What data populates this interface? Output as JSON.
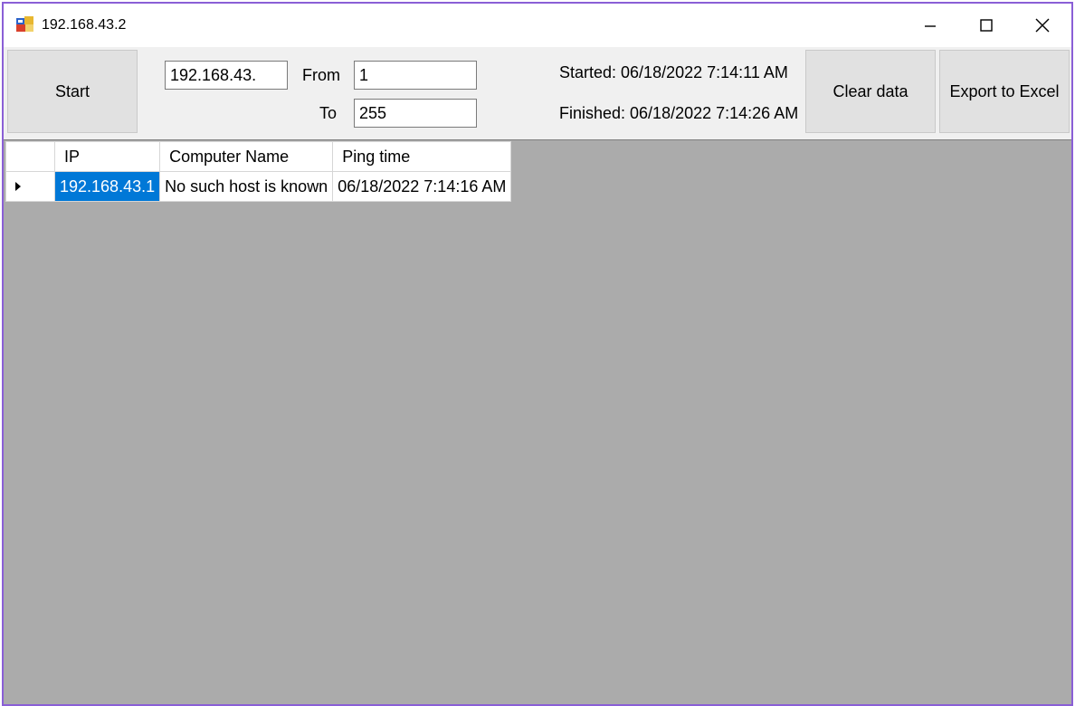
{
  "window": {
    "title": "192.168.43.2"
  },
  "toolbar": {
    "start_label": "Start",
    "ip_prefix_value": "192.168.43.",
    "from_label": "From",
    "from_value": "1",
    "to_label": "To",
    "to_value": "255",
    "started_text": "Started: 06/18/2022 7:14:11 AM",
    "finished_text": "Finished: 06/18/2022 7:14:26 AM",
    "clear_label": "Clear data",
    "export_label": "Export to Excel"
  },
  "grid": {
    "columns": [
      "IP",
      "Computer Name",
      "Ping time"
    ],
    "rows": [
      {
        "ip": "192.168.43.1",
        "name": "No such host is known",
        "time": "06/18/2022 7:14:16 AM"
      }
    ]
  },
  "colors": {
    "selection": "#0078d7",
    "grid_background": "#ababab",
    "window_border": "#8a5fd6",
    "button_face": "#e1e1e1"
  },
  "icons": {
    "app": "app-icon",
    "minimize": "minimize-icon",
    "maximize": "maximize-icon",
    "close": "close-icon",
    "row_indicator": "row-indicator-arrow-icon"
  }
}
